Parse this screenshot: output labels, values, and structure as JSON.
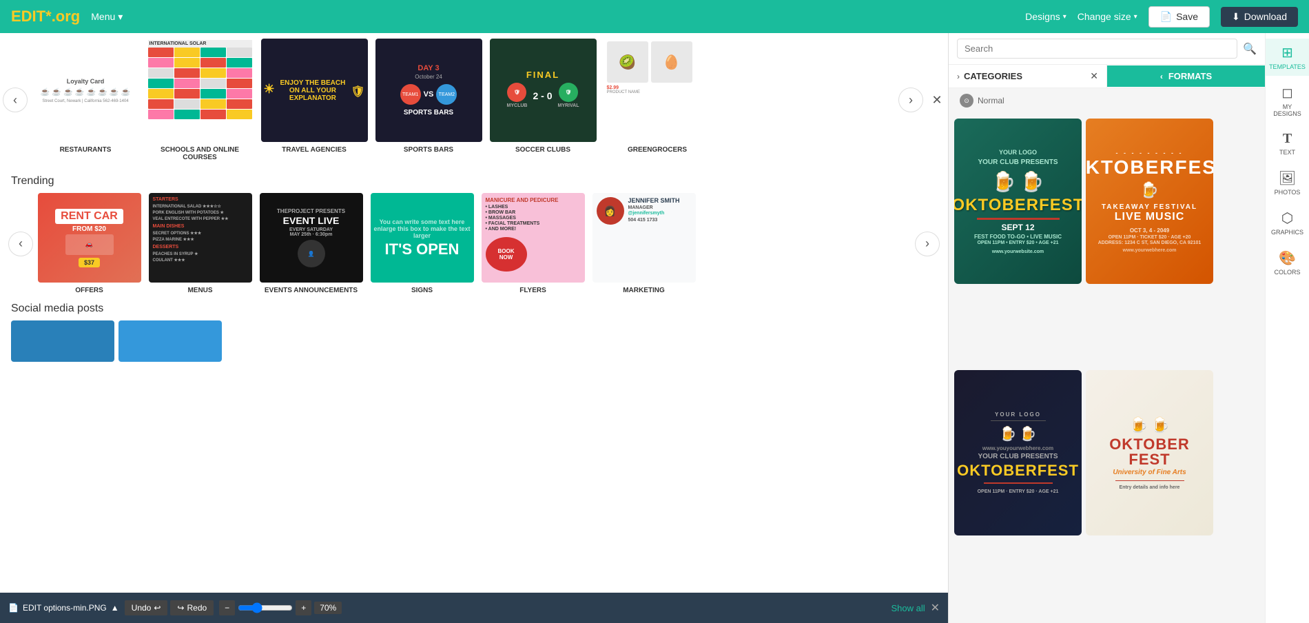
{
  "topbar": {
    "logo": "EDIT",
    "logo_star": "*",
    "logo_org": ".org",
    "menu_label": "Menu",
    "designs_label": "Designs",
    "change_size_label": "Change size",
    "save_label": "Save",
    "download_label": "Download"
  },
  "categories": {
    "title": "CATEGORIES",
    "items": [
      {
        "id": "restaurants",
        "label": "RESTAURANTS"
      },
      {
        "id": "schools",
        "label": "SCHOOLS AND ONLINE COURSES"
      },
      {
        "id": "travel",
        "label": "TRAVEL AGENCIES"
      },
      {
        "id": "sports",
        "label": "SPORTS BARS"
      },
      {
        "id": "soccer",
        "label": "SOCCER CLUBS"
      },
      {
        "id": "greengrocers",
        "label": "GREENGROCERS"
      }
    ]
  },
  "trending": {
    "title": "Trending",
    "items": [
      {
        "id": "offers",
        "label": "OFFERS",
        "text": "RENT CAR FROM $20 OFFERS"
      },
      {
        "id": "menus",
        "label": "MENUS"
      },
      {
        "id": "events",
        "label": "EVENTS ANNOUNCEMENTS",
        "text": "EVENT LIVE"
      },
      {
        "id": "signs",
        "label": "SIGNS",
        "text": "IT'S OPEN"
      },
      {
        "id": "flyers",
        "label": "FLYERS"
      },
      {
        "id": "marketing",
        "label": "MARKETING",
        "text": "JENNIFER SMITH MARKETING"
      }
    ]
  },
  "social": {
    "title": "Social media posts"
  },
  "search": {
    "placeholder": "Search"
  },
  "filter": {
    "categories_label": "CATEGORIES",
    "formats_label": "FORMATS"
  },
  "templates": {
    "normal_label": "Normal",
    "cards": [
      {
        "id": "okt1",
        "title": "OKTOBERFEST",
        "subtitle": "YOUR CLUB PRESENTS",
        "date": "SEPT 12",
        "style": "green"
      },
      {
        "id": "okt2",
        "title": "OKTOBERFEST",
        "subtitle": "OCT 3, 4 - 2049",
        "style": "orange"
      },
      {
        "id": "okt3",
        "title": "OKTOBERFEST",
        "subtitle": "YOUR CLUB PRESENTS",
        "style": "dark"
      },
      {
        "id": "okt4",
        "title": "OKTOBER FEST",
        "subtitle": "University of Fine Arts",
        "style": "beige"
      }
    ]
  },
  "side_icons": [
    {
      "id": "templates",
      "symbol": "⊞",
      "label": "TEMPLATES",
      "active": true
    },
    {
      "id": "my-designs",
      "symbol": "◻",
      "label": "MY DESIGNS",
      "active": false
    },
    {
      "id": "text",
      "symbol": "T",
      "label": "TEXT",
      "active": false
    },
    {
      "id": "photos",
      "symbol": "🖼",
      "label": "PHOTOS",
      "active": false
    },
    {
      "id": "graphics",
      "symbol": "⬡",
      "label": "GRAPHICS",
      "active": false
    },
    {
      "id": "colors",
      "symbol": "🎨",
      "label": "COLORS",
      "active": false
    }
  ],
  "bottom_bar": {
    "file_name": "EDIT options-min.PNG",
    "undo_label": "Undo",
    "redo_label": "Redo",
    "zoom_value": "70%",
    "show_all_label": "Show all"
  }
}
